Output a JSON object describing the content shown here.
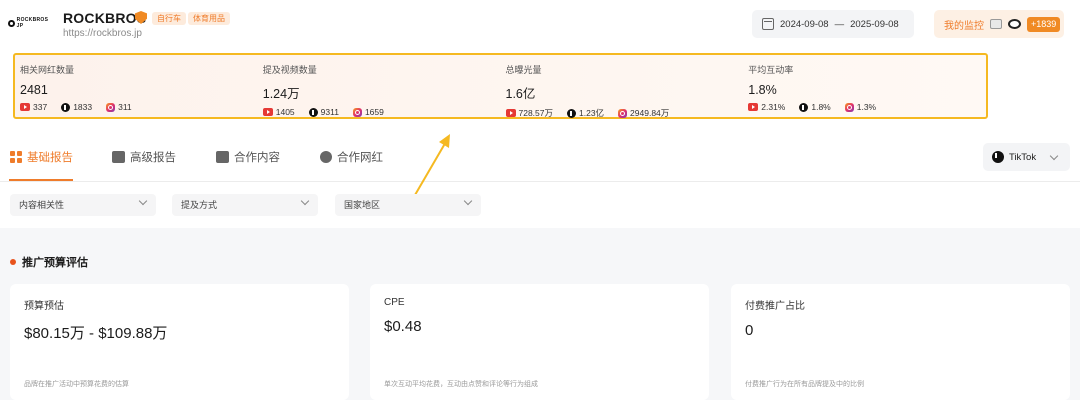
{
  "brand": {
    "name": "ROCKBROS",
    "url": "https://rockbros.jp",
    "tags": [
      "自行车",
      "体育用品"
    ],
    "logo_text": "ROCKBROS JP"
  },
  "date_range": {
    "start": "2024-09-08",
    "separator": "—",
    "end": "2025-09-08"
  },
  "monitor": {
    "label": "我的监控",
    "badge": "+1839"
  },
  "stats": [
    {
      "title": "相关网红数量",
      "value": "2481",
      "youtube": "337",
      "tiktok": "1833",
      "instagram": "311"
    },
    {
      "title": "提及视频数量",
      "value": "1.24万",
      "youtube": "1405",
      "tiktok": "9311",
      "instagram": "1659"
    },
    {
      "title": "总曝光量",
      "value": "1.6亿",
      "youtube": "728.57万",
      "tiktok": "1.23亿",
      "instagram": "2949.84万"
    },
    {
      "title": "平均互动率",
      "value": "1.8%",
      "youtube": "2.31%",
      "tiktok": "1.8%",
      "instagram": "1.3%"
    }
  ],
  "tabs": [
    {
      "label": "基础报告",
      "icon": "grid-icon"
    },
    {
      "label": "高级报告",
      "icon": "report-icon"
    },
    {
      "label": "合作内容",
      "icon": "image-icon"
    },
    {
      "label": "合作网红",
      "icon": "user-icon"
    }
  ],
  "platform": {
    "selected": "TikTok"
  },
  "filters": [
    "内容相关性",
    "提及方式",
    "国家地区"
  ],
  "section": {
    "title": "推广预算评估"
  },
  "cards": [
    {
      "title": "预算预估",
      "value": "$80.15万 - $109.88万",
      "note": "品牌在推广活动中预算花费的估算"
    },
    {
      "title": "CPE",
      "value": "$0.48",
      "note": "单次互动平均花费，互动由点赞和评论等行为组成"
    },
    {
      "title": "付费推广占比",
      "value": "0",
      "note": "付费推广行为在所有品牌提及中的比例"
    }
  ],
  "colors": {
    "accent": "#ef7c2b",
    "highlight": "#f5b921",
    "section_dot": "#e8531c"
  }
}
